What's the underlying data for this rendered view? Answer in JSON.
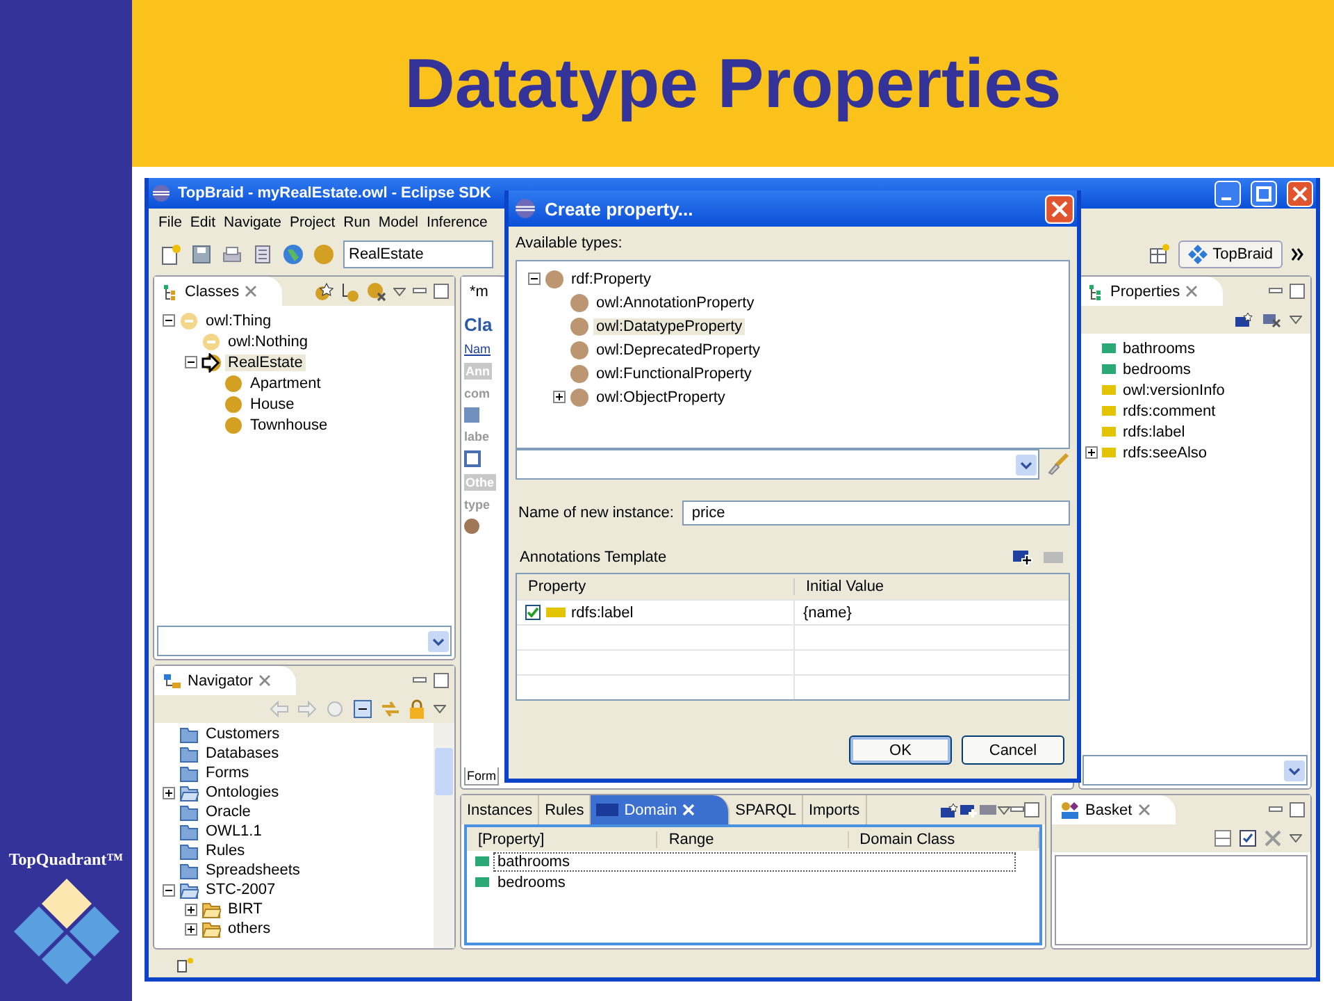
{
  "slide": {
    "title": "Datatype Properties",
    "brand": "TopQuadrant™"
  },
  "window": {
    "title": "TopBraid - myRealEstate.owl - Eclipse SDK",
    "menu": [
      "File",
      "Edit",
      "Navigate",
      "Project",
      "Run",
      "Model",
      "Inference"
    ],
    "class_combo": "RealEstate",
    "perspective": "TopBraid"
  },
  "classes_view": {
    "title": "Classes",
    "tree": [
      {
        "label": "owl:Thing",
        "kind": "system-class",
        "selected": false,
        "expanded": true,
        "children": [
          {
            "label": "owl:Nothing",
            "kind": "system-class",
            "selected": false
          },
          {
            "label": "RealEstate",
            "kind": "current-class",
            "selected": true,
            "expanded": true,
            "children": [
              {
                "label": "Apartment",
                "kind": "class",
                "selected": false
              },
              {
                "label": "House",
                "kind": "class",
                "selected": false
              },
              {
                "label": "Townhouse",
                "kind": "class",
                "selected": false
              }
            ]
          }
        ]
      }
    ]
  },
  "navigator": {
    "title": "Navigator",
    "tree": [
      {
        "label": "Customers",
        "kind": "folder"
      },
      {
        "label": "Databases",
        "kind": "folder"
      },
      {
        "label": "Forms",
        "kind": "folder"
      },
      {
        "label": "Ontologies",
        "kind": "linked-folder",
        "expanded": false
      },
      {
        "label": "Oracle",
        "kind": "folder"
      },
      {
        "label": "OWL1.1",
        "kind": "folder"
      },
      {
        "label": "Rules",
        "kind": "folder"
      },
      {
        "label": "Spreadsheets",
        "kind": "folder"
      },
      {
        "label": "STC-2007",
        "kind": "linked-folder",
        "expanded": true,
        "children": [
          {
            "label": "BIRT",
            "kind": "open-folder",
            "expanded": false
          },
          {
            "label": "others",
            "kind": "open-folder",
            "expanded": false
          }
        ]
      }
    ]
  },
  "editor": {
    "tab": "*m",
    "heading": "Cla",
    "name_link": "Nam",
    "section_1": "Ann",
    "field_1": "com",
    "field_2": "labe",
    "section_2": "Othe",
    "field_3": "type",
    "bottom_tab": "Form"
  },
  "bottom_view": {
    "tabs": [
      {
        "label": "Instances",
        "selected": false
      },
      {
        "label": "Rules",
        "selected": false
      },
      {
        "label": "Domain",
        "selected": true
      },
      {
        "label": "SPARQL",
        "selected": false
      },
      {
        "label": "Imports",
        "selected": false
      }
    ],
    "columns": [
      "[Property]",
      "Range",
      "Domain Class"
    ],
    "rows": [
      {
        "label": "bathrooms",
        "selected": true
      },
      {
        "label": "bedrooms",
        "selected": false
      }
    ]
  },
  "properties_view": {
    "title": "Properties",
    "items": [
      {
        "label": "bathrooms",
        "color": "#2aa876"
      },
      {
        "label": "bedrooms",
        "color": "#2aa876"
      },
      {
        "label": "owl:versionInfo",
        "color": "#e2c400"
      },
      {
        "label": "rdfs:comment",
        "color": "#e2c400"
      },
      {
        "label": "rdfs:label",
        "color": "#e2c400"
      },
      {
        "label": "rdfs:seeAlso",
        "color": "#e2c400",
        "expanded": false
      }
    ]
  },
  "basket": {
    "title": "Basket"
  },
  "dialog": {
    "title": "Create property...",
    "types_label": "Available types:",
    "tree": [
      {
        "label": "rdf:Property",
        "kind": "property",
        "selected": false,
        "expanded": true,
        "children": [
          {
            "label": "owl:AnnotationProperty",
            "kind": "property",
            "selected": false
          },
          {
            "label": "owl:DatatypeProperty",
            "kind": "property",
            "selected": true
          },
          {
            "label": "owl:DeprecatedProperty",
            "kind": "property",
            "selected": false
          },
          {
            "label": "owl:FunctionalProperty",
            "kind": "property",
            "selected": false
          },
          {
            "label": "owl:ObjectProperty",
            "kind": "property",
            "selected": false,
            "expanded": false
          }
        ]
      }
    ],
    "name_label": "Name of new instance:",
    "name_value": "price",
    "annotations_label": "Annotations Template",
    "columns": [
      "Property",
      "Initial Value"
    ],
    "rows": [
      {
        "checked": true,
        "property": "rdfs:label",
        "value": "{name}"
      }
    ],
    "buttons": [
      "OK",
      "Cancel"
    ]
  }
}
